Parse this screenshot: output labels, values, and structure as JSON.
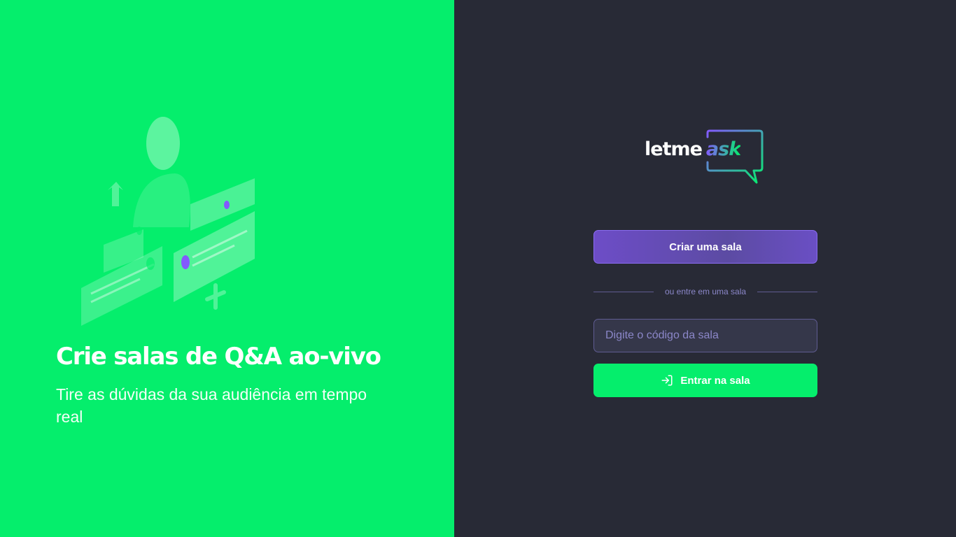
{
  "aside": {
    "title": "Crie salas de Q&A ao-vivo",
    "subtitle": "Tire as dúvidas da sua audiência em tempo real"
  },
  "logo": {
    "part1": "letme",
    "part2": "ask"
  },
  "actions": {
    "create_room": "Criar uma sala",
    "separator": "ou entre em uma sala",
    "room_code_placeholder": "Digite o código da sala",
    "enter_room": "Entrar na sala",
    "enter_icon": "log-in-icon"
  },
  "colors": {
    "brand_green": "#05ee6c",
    "brand_purple": "#835afd",
    "background_dark": "#282a36"
  }
}
